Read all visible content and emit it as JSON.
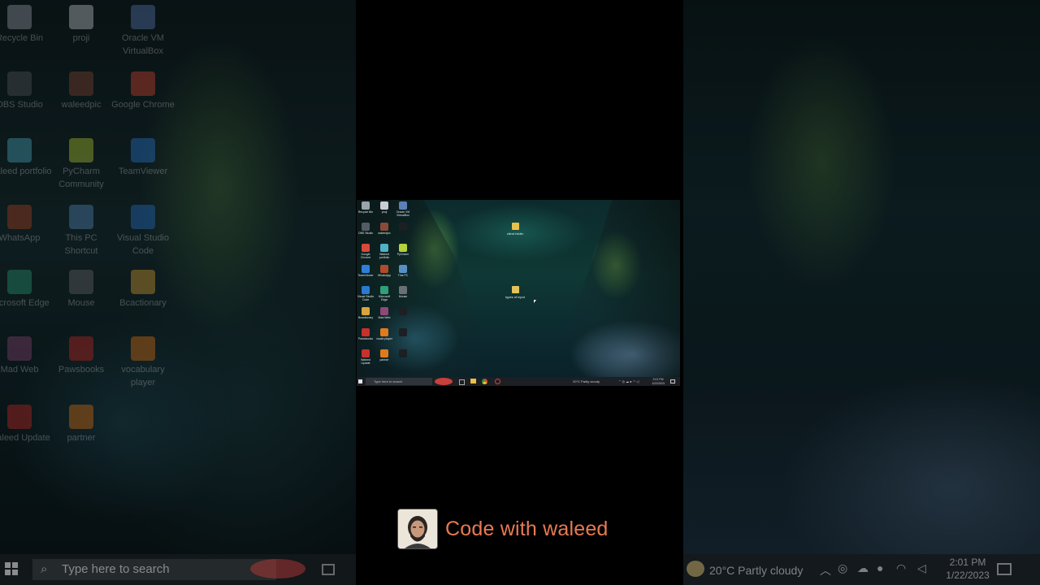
{
  "left_desktop": {
    "icons": [
      {
        "label": "Recycle Bin",
        "icon": "recycle-bin-icon",
        "color": "#9aa4ad"
      },
      {
        "label": "proji",
        "icon": "file-icon",
        "color": "#c9ced4"
      },
      {
        "label": "Oracle VM VirtualBox",
        "icon": "virtualbox-icon",
        "color": "#5b7fb8"
      },
      {
        "label": "OBS Studio",
        "icon": "obs-icon",
        "color": "#555b62"
      },
      {
        "label": "waleedpic",
        "icon": "photo-icon",
        "color": "#8a4a3a"
      },
      {
        "label": "Google Chrome",
        "icon": "chrome-icon",
        "color": "#d8493b"
      },
      {
        "label": "Waleed portfolio",
        "icon": "document-icon",
        "color": "#4fb0c6"
      },
      {
        "label": "PyCharm Community",
        "icon": "pycharm-icon",
        "color": "#b4d23a"
      },
      {
        "label": "TeamViewer",
        "icon": "teamviewer-icon",
        "color": "#2f7fd8"
      },
      {
        "label": "WhatsApp",
        "icon": "whatsapp-icon",
        "color": "#b04b2a"
      },
      {
        "label": "This PC Shortcut",
        "icon": "computer-icon",
        "color": "#5a8fc4"
      },
      {
        "label": "Visual Studio Code",
        "icon": "vscode-icon",
        "color": "#2b7ad0"
      },
      {
        "label": "Microsoft Edge",
        "icon": "edge-icon",
        "color": "#2fa07a"
      },
      {
        "label": "Mouse",
        "icon": "app-icon",
        "color": "#6b6f76"
      },
      {
        "label": "Bcactionary",
        "icon": "folder-icon",
        "color": "#d8a63a"
      },
      {
        "label": "Mad Web",
        "icon": "app-icon",
        "color": "#8d4a78"
      },
      {
        "label": "Pawsbooks",
        "icon": "pdf-icon",
        "color": "#c8302c"
      },
      {
        "label": "vocabulary player",
        "icon": "vlc-icon",
        "color": "#e07a1c"
      },
      {
        "label": "Waleed Update",
        "icon": "pdf-icon",
        "color": "#c8302c"
      },
      {
        "label": "partner",
        "icon": "vlc-icon",
        "color": "#e07a1c"
      }
    ],
    "taskbar_search": "Type here to search"
  },
  "right_desktop": {
    "weather": "20°C  Partly cloudy",
    "time": "2:01 PM",
    "date": "1/22/2023"
  },
  "center_desktop": {
    "mini_icons": [
      {
        "label": "Recycle Bin",
        "color": "#9aa4ad"
      },
      {
        "label": "proji",
        "color": "#c9ced4"
      },
      {
        "label": "Oracle VM VirtualBox",
        "color": "#5b7fb8"
      },
      {
        "label": "OBS Studio",
        "color": "#555b62"
      },
      {
        "label": "waleedpic",
        "color": "#8a4a3a"
      },
      {
        "label": "",
        "color": "#1c1f24"
      },
      {
        "label": "Google Chrome",
        "color": "#d8493b"
      },
      {
        "label": "Waleed portfolio",
        "color": "#4fb0c6"
      },
      {
        "label": "PyCharm",
        "color": "#b4d23a"
      },
      {
        "label": "TeamViewer",
        "color": "#2f7fd8"
      },
      {
        "label": "WhatsApp",
        "color": "#b04b2a"
      },
      {
        "label": "This PC",
        "color": "#5a8fc4"
      },
      {
        "label": "Visual Studio Code",
        "color": "#2b7ad0"
      },
      {
        "label": "Microsoft Edge",
        "color": "#2fa07a"
      },
      {
        "label": "Mouse",
        "color": "#6b6f76"
      },
      {
        "label": "Bcactionary",
        "color": "#d8a63a"
      },
      {
        "label": "Mad Web",
        "color": "#8d4a78"
      },
      {
        "label": "",
        "color": "#1c1f24"
      },
      {
        "label": "Pawsbooks",
        "color": "#c8302c"
      },
      {
        "label": "vocab player",
        "color": "#e07a1c"
      },
      {
        "label": "",
        "color": "#1c1f24"
      },
      {
        "label": "Waleed Update",
        "color": "#c8302c"
      },
      {
        "label": "partner",
        "color": "#e07a1c"
      },
      {
        "label": "",
        "color": "#1c1f24"
      }
    ],
    "folder1": "client folder",
    "folder2": "types of input",
    "taskbar_search": "Type here to search",
    "tray": "20°C  Partly cloudy",
    "time": "2:01 PM",
    "date": "1/22/2023"
  },
  "channel": {
    "name": "Code with waleed",
    "accent_color": "#e87a52"
  }
}
